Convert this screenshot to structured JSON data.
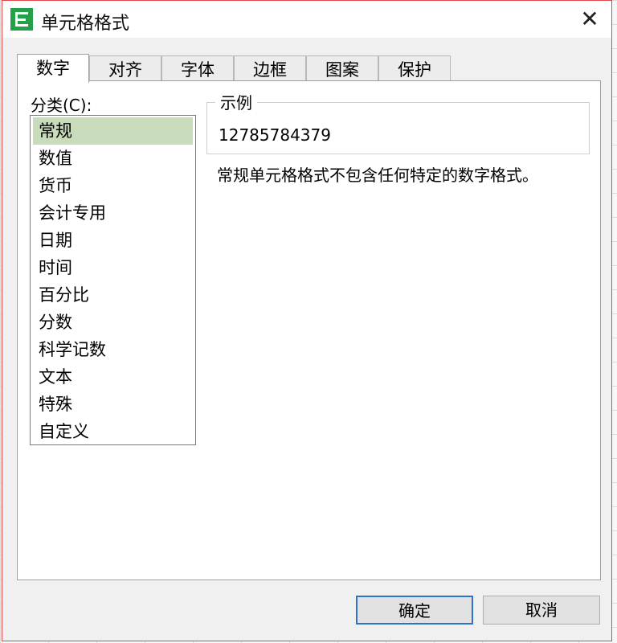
{
  "window": {
    "title": "单元格格式",
    "close": "✕"
  },
  "tabs": [
    "数字",
    "对齐",
    "字体",
    "边框",
    "图案",
    "保护"
  ],
  "category": {
    "label": "分类(C):",
    "items": [
      "常规",
      "数值",
      "货币",
      "会计专用",
      "日期",
      "时间",
      "百分比",
      "分数",
      "科学记数",
      "文本",
      "特殊",
      "自定义"
    ],
    "selected": "常规"
  },
  "sample": {
    "title": "示例",
    "value": "12785784379"
  },
  "description": "常规单元格格式不包含任何特定的数字格式。",
  "buttons": {
    "ok": "确定",
    "cancel": "取消"
  }
}
